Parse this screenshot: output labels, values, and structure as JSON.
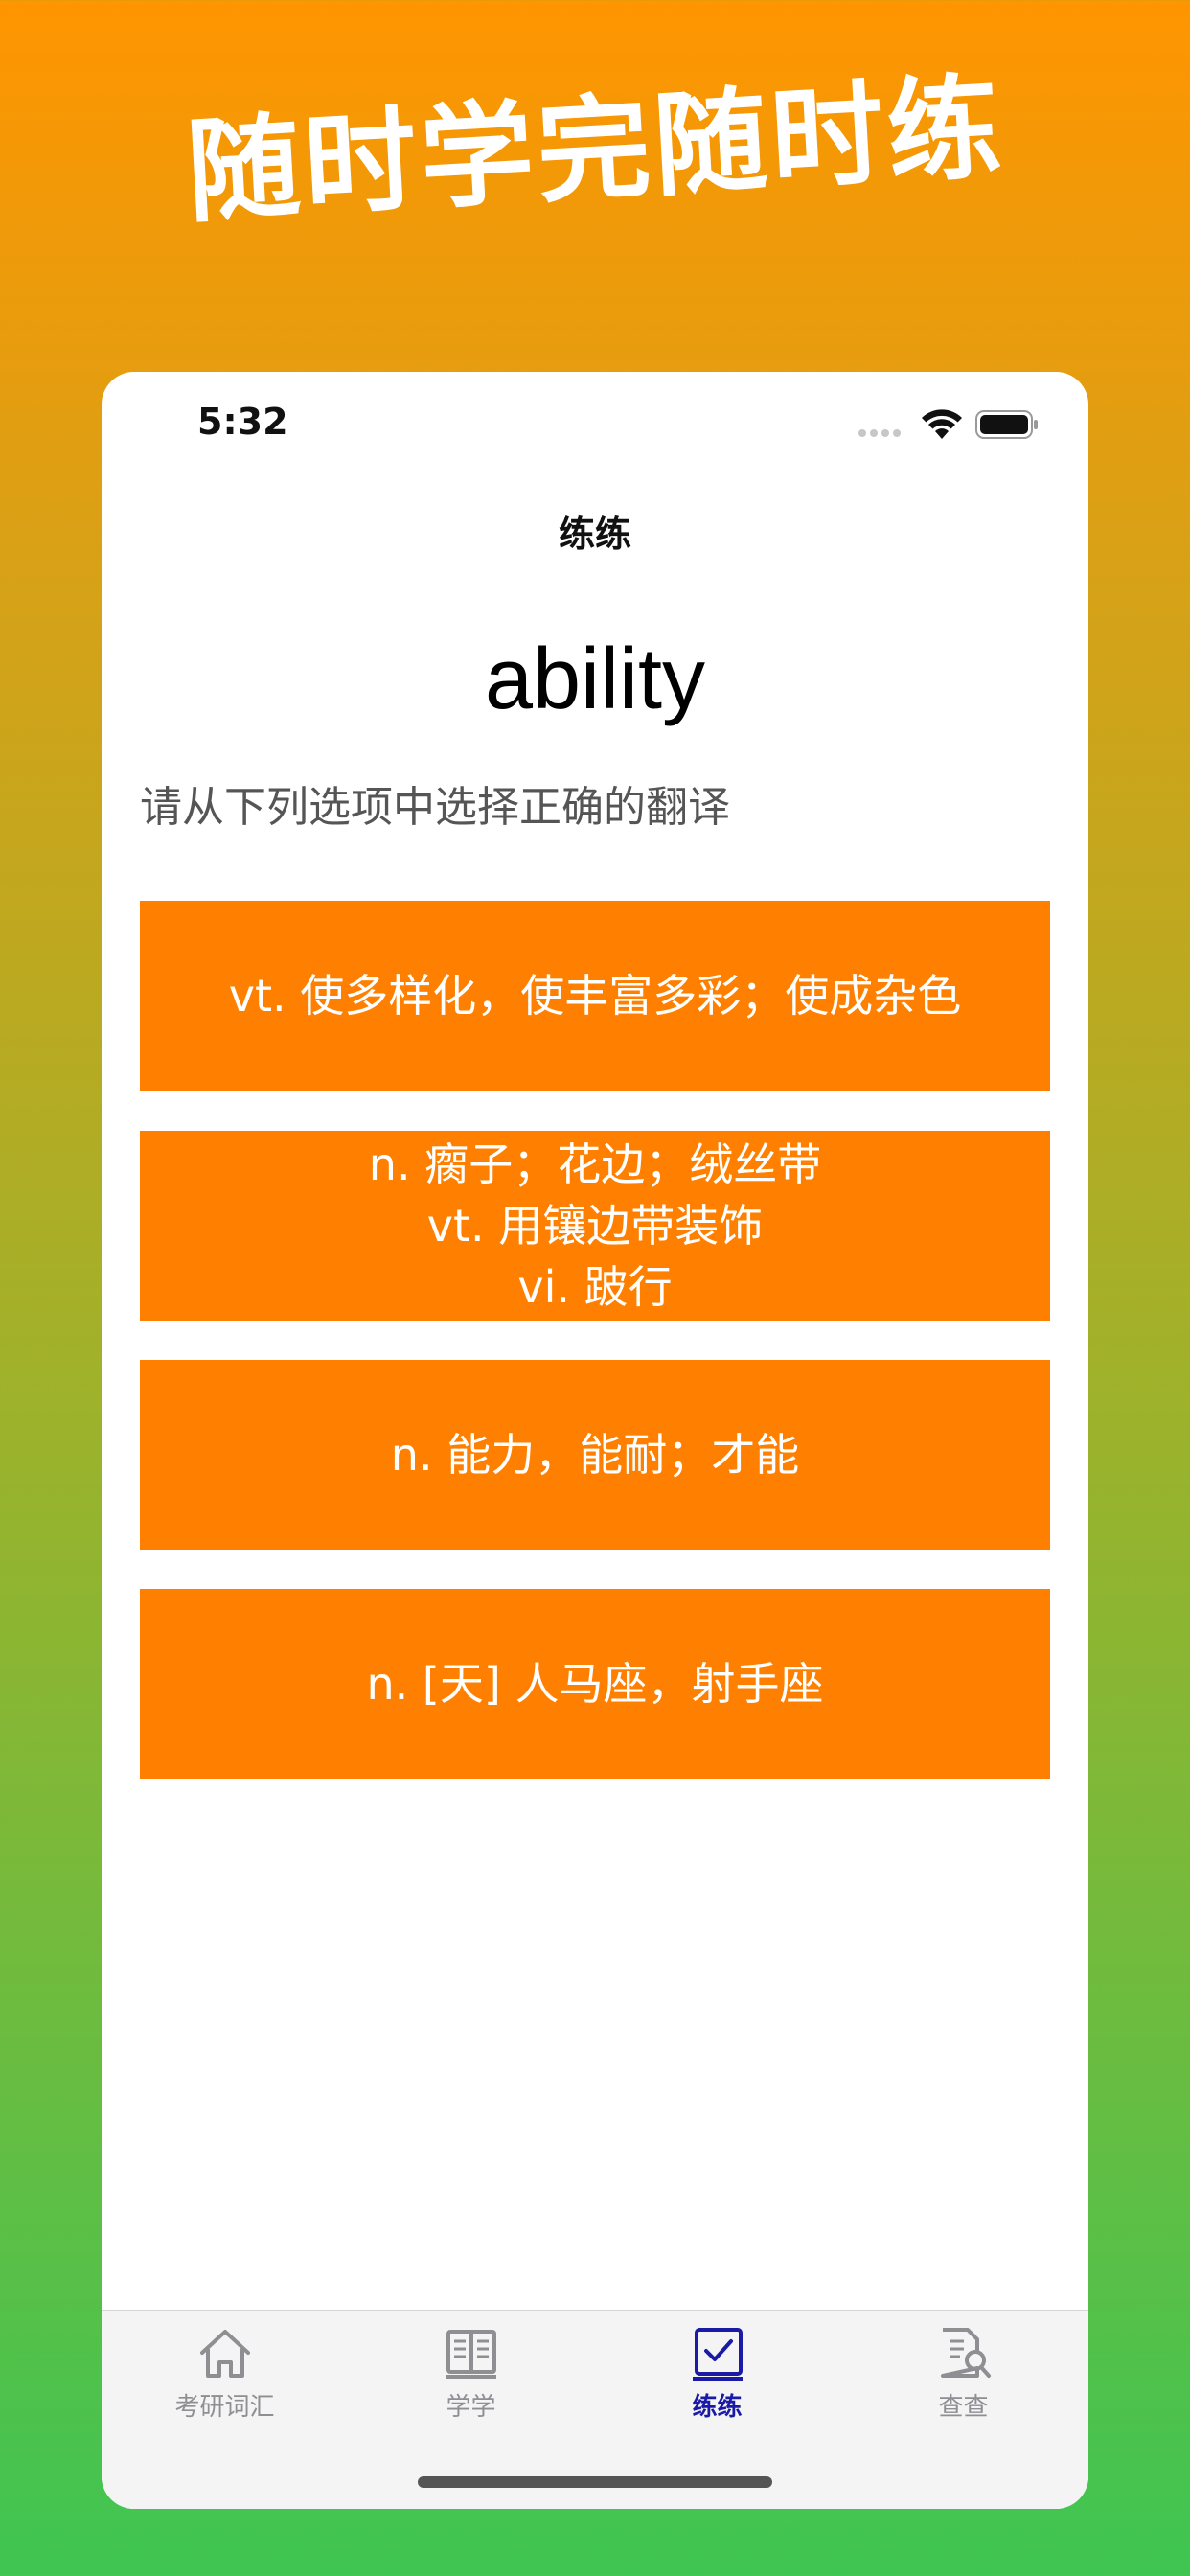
{
  "promo": {
    "title": "随时学完随时练"
  },
  "status_bar": {
    "time": "5:32"
  },
  "nav": {
    "title": "练练"
  },
  "quiz": {
    "word": "ability",
    "instruction": "请从下列选项中选择正确的翻译",
    "options": [
      {
        "lines": [
          "vt. 使多样化，使丰富多彩；使成杂色"
        ]
      },
      {
        "lines": [
          "n. 瘸子；花边；绒丝带",
          "vt. 用镶边带装饰",
          "vi. 跛行"
        ]
      },
      {
        "lines": [
          "n. 能力，能耐；才能"
        ]
      },
      {
        "lines": [
          "n. [天] 人马座，射手座"
        ]
      }
    ]
  },
  "tabs": [
    {
      "label": "考研词汇",
      "icon": "house-icon",
      "active": false
    },
    {
      "label": "学学",
      "icon": "book-icon",
      "active": false
    },
    {
      "label": "练练",
      "icon": "checkbox-icon",
      "active": true
    },
    {
      "label": "查查",
      "icon": "document-search-icon",
      "active": false
    }
  ],
  "colors": {
    "option_bg": "#FF8000",
    "active_tab": "#1A1AA6",
    "inactive_tab": "#8E8E93",
    "gradient_top": "#FF9500",
    "gradient_bottom": "#3FC552"
  }
}
